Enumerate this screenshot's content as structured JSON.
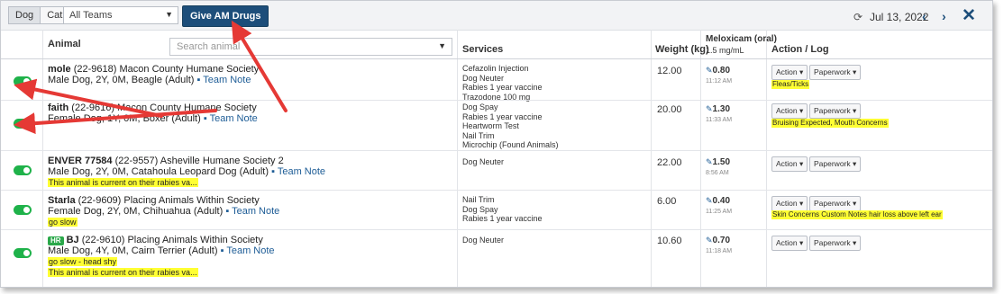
{
  "toolbar": {
    "species": [
      "Dog",
      "Cat"
    ],
    "team_select": "All Teams",
    "give_button": "Give AM Drugs",
    "date": "Jul 13, 2022"
  },
  "columns": {
    "animal": "Animal",
    "search_placeholder": "Search animal",
    "services": "Services",
    "weight": "Weight (kg)",
    "med_line1": "Meloxicam (oral)",
    "med_line2": "1.5 mg/mL",
    "action": "Action / Log"
  },
  "buttons": {
    "action": "Action",
    "paperwork": "Paperwork"
  },
  "team_note": "Team Note",
  "rows": [
    {
      "name": "mole",
      "id": "(22-9618) Macon County Humane Society",
      "desc": "Male Dog, 2Y, 0M, Beagle (Adult)",
      "alerts": [],
      "services": [
        "Cefazolin Injection",
        "Dog Neuter",
        "Rabies 1 year vaccine",
        "Trazodone 100 mg"
      ],
      "weight": "12.00",
      "dose": "0.80",
      "time": "11:12 AM",
      "flag": "Fleas/Ticks"
    },
    {
      "name": "faith",
      "id": "(22-9616) Macon County Humane Society",
      "desc": "Female Dog, 1Y, 0M, Boxer (Adult)",
      "alerts": [],
      "services": [
        "Dog Spay",
        "Rabies 1 year vaccine",
        "Heartworm Test",
        "Nail Trim",
        "Microchip (Found Animals)"
      ],
      "weight": "20.00",
      "dose": "1.30",
      "time": "11:33 AM",
      "flag": "Bruising Expected, Mouth Concerns"
    },
    {
      "name": "ENVER 77584",
      "id": "(22-9557) Asheville Humane Society 2",
      "desc": "Male Dog, 2Y, 0M, Catahoula Leopard Dog (Adult)",
      "alerts": [
        "This animal is current on their rabies va..."
      ],
      "services": [
        "Dog Neuter"
      ],
      "weight": "22.00",
      "dose": "1.50",
      "time": "8:56 AM",
      "flag": ""
    },
    {
      "name": "Starla",
      "id": "(22-9609) Placing Animals Within Society",
      "desc": "Female Dog, 2Y, 0M, Chihuahua (Adult)",
      "alerts": [
        "go slow"
      ],
      "services": [
        "Nail Trim",
        "Dog Spay",
        "Rabies 1 year vaccine"
      ],
      "weight": "6.00",
      "dose": "0.40",
      "time": "11:25 AM",
      "flag": "Skin Concerns Custom Notes hair loss above left ear"
    },
    {
      "name": "BJ",
      "badge": "HR",
      "id": "(22-9610) Placing Animals Within Society",
      "desc": "Male Dog, 4Y, 0M, Cairn Terrier (Adult)",
      "alerts": [
        "go slow - head shy",
        "This animal is current on their rabies va..."
      ],
      "services": [
        "Dog Neuter"
      ],
      "weight": "10.60",
      "dose": "0.70",
      "time": "11:18 AM",
      "flag": ""
    }
  ]
}
